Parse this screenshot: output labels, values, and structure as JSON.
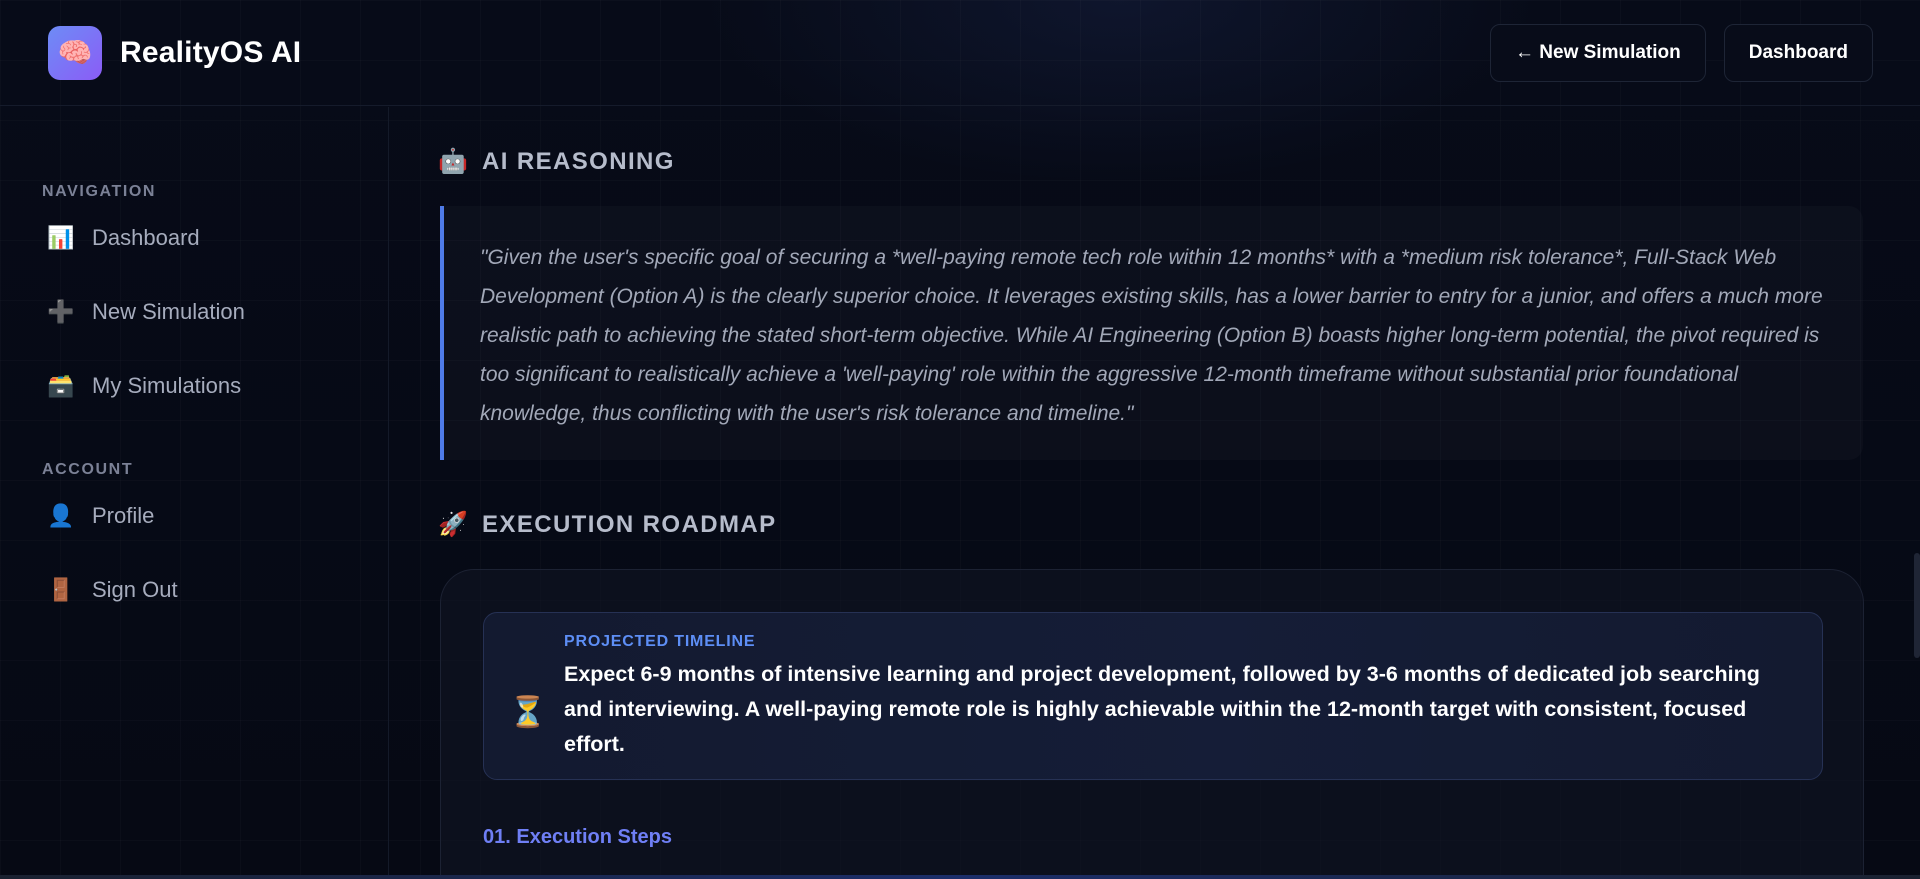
{
  "app": {
    "name": "RealityOS AI",
    "logo_icon": "🧠"
  },
  "header": {
    "new_simulation_label": "← New Simulation",
    "dashboard_label": "Dashboard"
  },
  "sidebar": {
    "navigation_title": "NAVIGATION",
    "account_title": "ACCOUNT",
    "nav_items": [
      {
        "icon": "📊",
        "label": "Dashboard"
      },
      {
        "icon": "➕",
        "label": "New Simulation"
      },
      {
        "icon": "🗃️",
        "label": "My Simulations"
      }
    ],
    "account_items": [
      {
        "icon": "👤",
        "label": "Profile"
      },
      {
        "icon": "🚪",
        "label": "Sign Out"
      }
    ]
  },
  "reasoning": {
    "icon": "🤖",
    "title": "AI REASONING",
    "quote": "\"Given the user's specific goal of securing a *well-paying remote tech role within 12 months* with a *medium risk tolerance*, Full-Stack Web Development (Option A) is the clearly superior choice. It leverages existing skills, has a lower barrier to entry for a junior, and offers a much more realistic path to achieving the stated short-term objective. While AI Engineering (Option B) boasts higher long-term potential, the pivot required is too significant to realistically achieve a 'well-paying' role within the aggressive 12-month timeframe without substantial prior foundational knowledge, thus conflicting with the user's risk tolerance and timeline.\""
  },
  "roadmap": {
    "icon": "🚀",
    "title": "EXECUTION ROADMAP",
    "timeline_icon": "⏳",
    "timeline_label": "PROJECTED TIMELINE",
    "timeline_text": "Expect 6-9 months of intensive learning and project development, followed by 3-6 months of dedicated job searching and interviewing. A well-paying remote role is highly achievable within the 12-month target with consistent, focused effort.",
    "steps_title": "01. Execution Steps"
  },
  "colors": {
    "background": "#070b18",
    "accent_blue": "#4f7be8",
    "accent_purple": "#8b5cf6",
    "timeline_label": "#5d8ef5",
    "steps_title": "#6f7ff5"
  }
}
